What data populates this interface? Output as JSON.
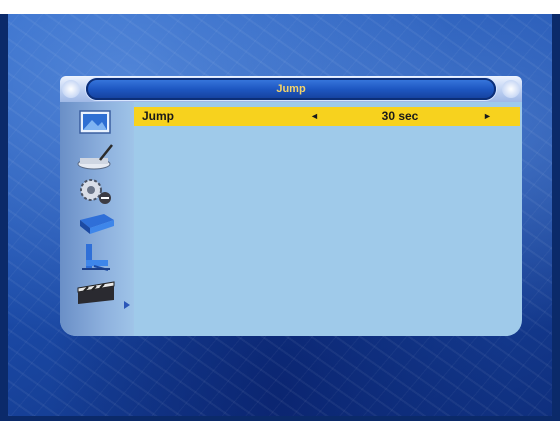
{
  "menu": {
    "title": "Jump",
    "sidebar_icons": [
      "screen-picture-icon",
      "dish-antenna-icon",
      "settings-gear-icon",
      "tools-icon",
      "chair-icon",
      "movie-clapper-icon"
    ],
    "selected_index": 5
  },
  "settings": {
    "rows": [
      {
        "label": "Jump",
        "value": "30 sec",
        "left_arrow": "◄",
        "right_arrow": "►"
      }
    ]
  },
  "colors": {
    "highlight": "#f7d21e",
    "panel": "#9fcaea",
    "title_text": "#f3d36b"
  }
}
